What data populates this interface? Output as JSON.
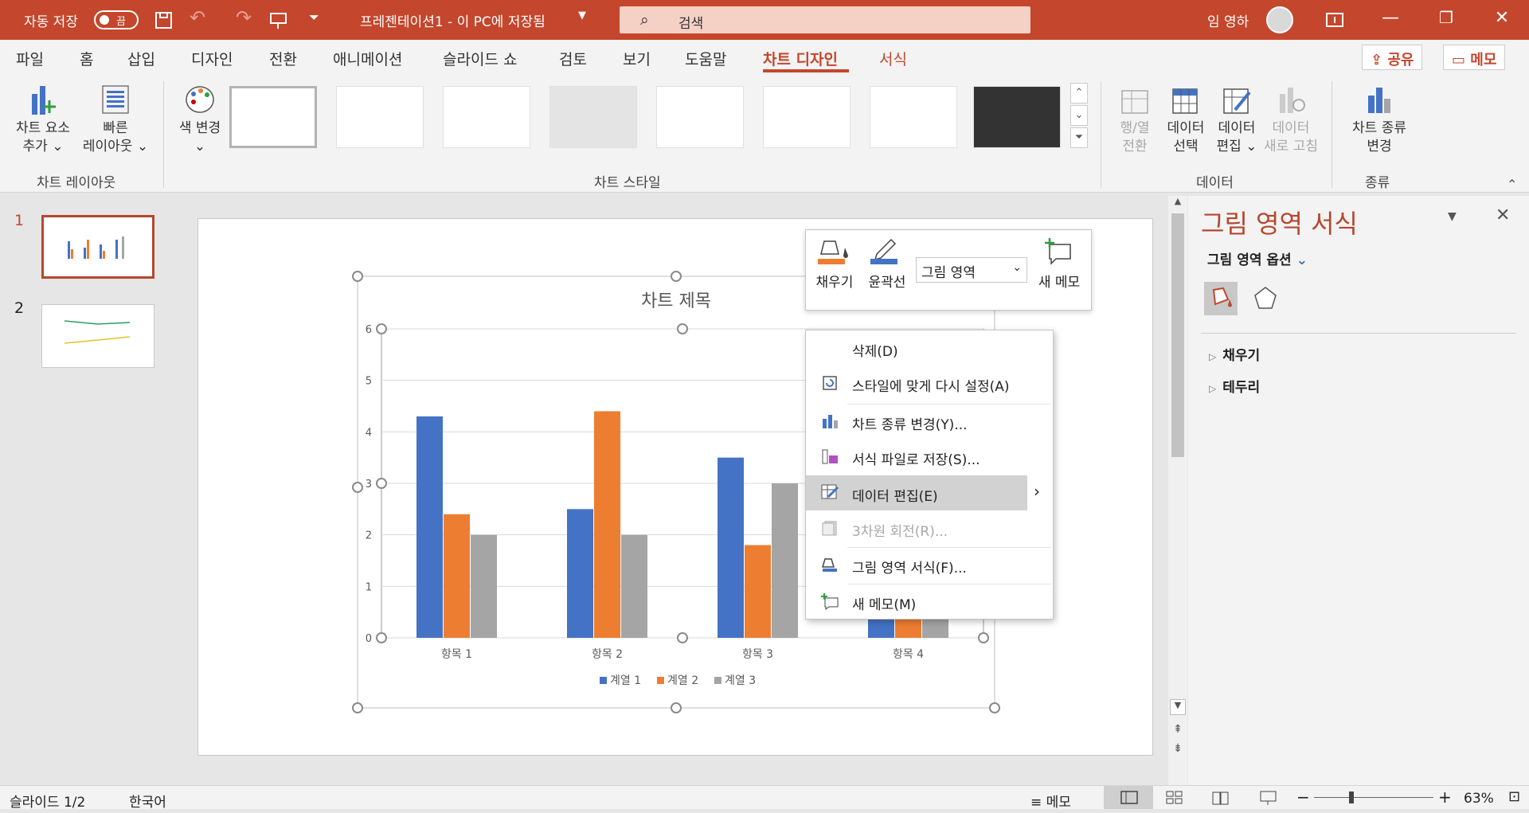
{
  "titlebar": {
    "autosave_label": "자동 저장",
    "autosave_state": "끔",
    "doc_title": "프레젠테이션1  -  이 PC에 저장됨",
    "search_placeholder": "검색",
    "user_name": "임 영하"
  },
  "tabs": [
    "파일",
    "홈",
    "삽입",
    "디자인",
    "전환",
    "애니메이션",
    "슬라이드 쇼",
    "검토",
    "보기",
    "도움말",
    "차트 디자인",
    "서식"
  ],
  "top_buttons": {
    "share": "공유",
    "comments": "메모"
  },
  "ribbon": {
    "add_element": [
      "차트 요소",
      "추가 ⌄"
    ],
    "quick_layout": [
      "빠른",
      "레이아웃 ⌄"
    ],
    "change_color": [
      "색 변경",
      "⌄"
    ],
    "switch_rowcol": [
      "행/열",
      "전환"
    ],
    "select_data": [
      "데이터",
      "선택"
    ],
    "edit_data": [
      "데이터",
      "편집 ⌄"
    ],
    "refresh_data": [
      "데이터",
      "새로 고침"
    ],
    "change_type": [
      "차트 종류",
      "변경"
    ],
    "groups": {
      "layout": "차트 레이아웃",
      "styles": "차트 스타일",
      "data": "데이터",
      "type": "종류"
    }
  },
  "slides": {
    "numbers": [
      "1",
      "2"
    ]
  },
  "chart_data": {
    "type": "bar",
    "title": "차트 제목",
    "categories": [
      "항목 1",
      "항목 2",
      "항목 3",
      "항목 4"
    ],
    "series": [
      {
        "name": "계열 1",
        "values": [
          4.3,
          2.5,
          3.5,
          4.5
        ],
        "color": "#4472c4"
      },
      {
        "name": "계열 2",
        "values": [
          2.4,
          4.4,
          1.8,
          2.8
        ],
        "color": "#ed7d31"
      },
      {
        "name": "계열 3",
        "values": [
          2,
          2,
          3,
          5
        ],
        "color": "#a5a5a5"
      }
    ],
    "ylim": [
      0,
      6
    ],
    "yticks": [
      "0",
      "1",
      "2",
      "3",
      "4",
      "5",
      "6"
    ],
    "grid": true,
    "legend": "bottom"
  },
  "floatbar": {
    "fill": "채우기",
    "outline": "윤곽선",
    "dropdown_value": "그림 영역",
    "new_comment": "새 메모"
  },
  "context_menu": [
    "삭제(D)",
    "스타일에 맞게 다시 설정(A)",
    "차트 종류 변경(Y)...",
    "서식 파일로 저장(S)...",
    "데이터 편집(E)",
    "3차원 회전(R)...",
    "그림 영역 서식(F)...",
    "새 메모(M)"
  ],
  "pane": {
    "title": "그림 영역 서식",
    "options_label": "그림 영역 옵션",
    "sections": [
      "채우기",
      "테두리"
    ]
  },
  "status": {
    "slide_info": "슬라이드 1/2",
    "language": "한국어",
    "notes": "메모",
    "zoom": "63%"
  }
}
